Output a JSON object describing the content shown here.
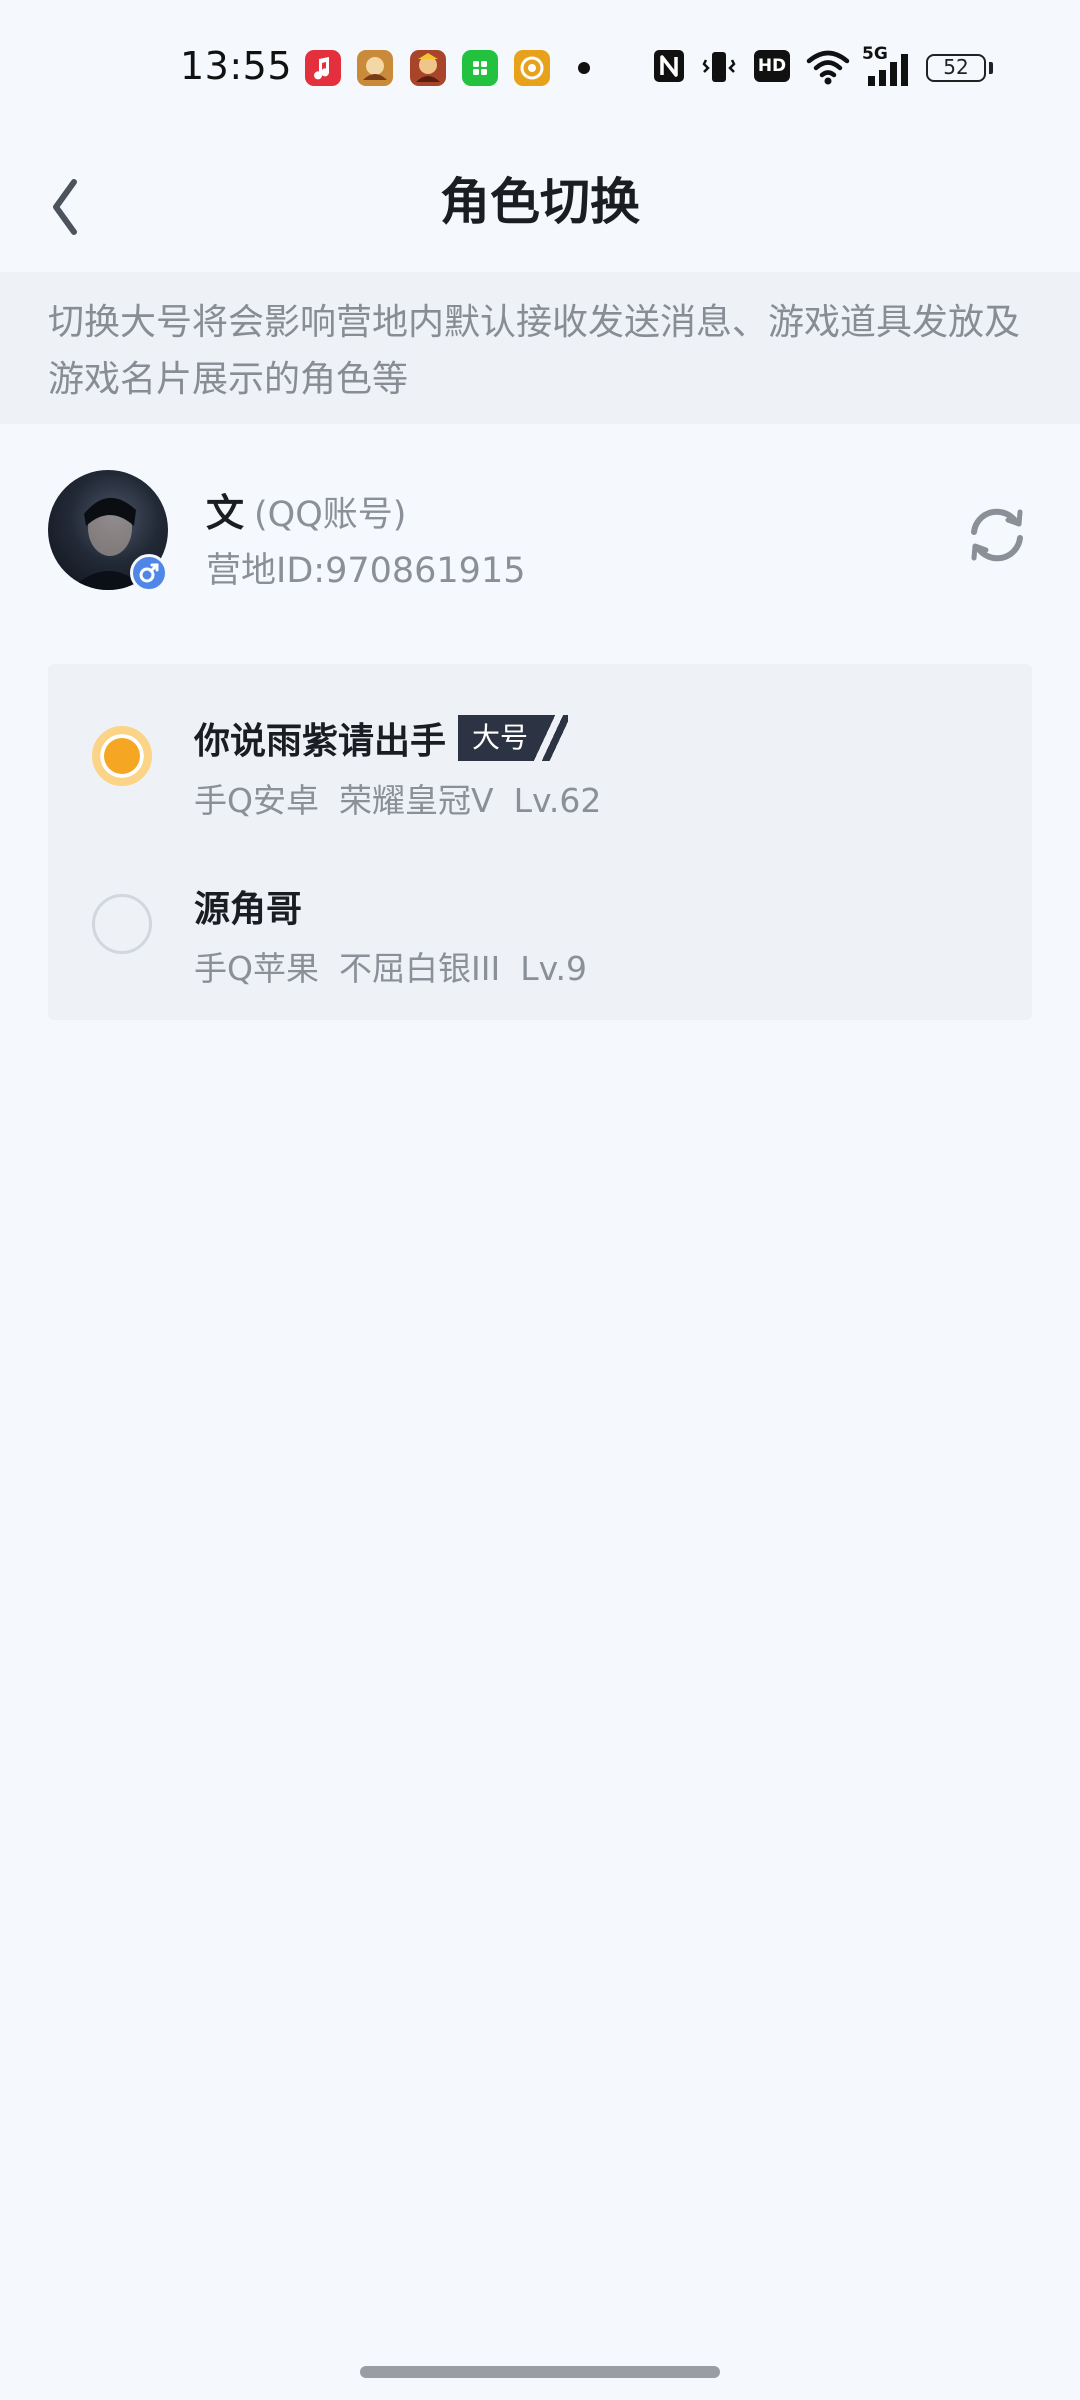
{
  "status_bar": {
    "time": "13:55",
    "network": "5G",
    "hd_label": "HD",
    "battery": "52",
    "icons": [
      "music-app-icon",
      "game-app-icon",
      "game-app-icon-2",
      "green-app-icon",
      "orange-app-icon",
      "notification-dot",
      "nfc-icon",
      "vibrate-icon",
      "hd-icon",
      "wifi-icon",
      "signal-icon",
      "battery-icon"
    ]
  },
  "header": {
    "title": "角色切换",
    "back_icon": "chevron-left-icon"
  },
  "notice": {
    "text": "切换大号将会影响营地内默认接收发送消息、游戏道具发放及游戏名片展示的角色等"
  },
  "account": {
    "name": "文",
    "type": "(QQ账号)",
    "id": "营地ID:970861915",
    "gender_icon": "male-icon",
    "refresh_icon": "refresh-icon"
  },
  "roles": [
    {
      "name": "你说雨紫请出手",
      "badge": "大号",
      "platform": "手Q安卓",
      "rank": "荣耀皇冠V",
      "level": "Lv.62",
      "selected": true
    },
    {
      "name": "源角哥",
      "badge": "",
      "platform": "手Q苹果",
      "rank": "不屈白银III",
      "level": "Lv.9",
      "selected": false
    }
  ],
  "colors": {
    "background": "#f5f8fd",
    "selected_radio": "#f5a623",
    "badge_bg": "#2c3342",
    "gender_badge": "#4f86e8"
  }
}
